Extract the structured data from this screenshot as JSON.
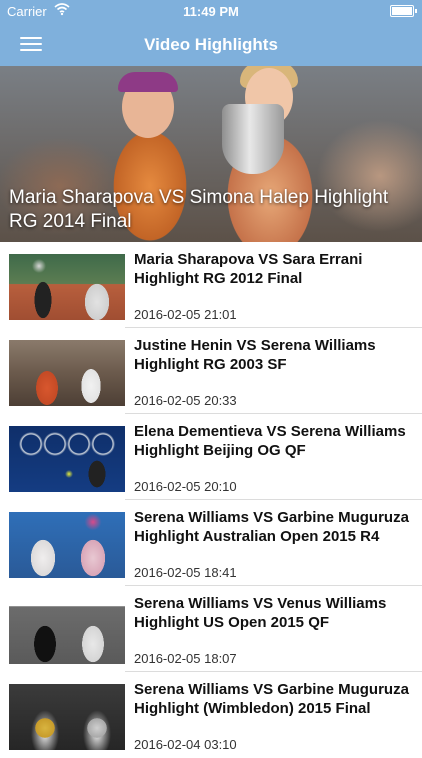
{
  "status_bar": {
    "carrier": "Carrier",
    "wifi_icon": "wifi-icon",
    "time": "11:49 PM",
    "battery_icon": "battery-icon",
    "battery_level": 1.0
  },
  "nav": {
    "menu_icon": "hamburger-menu-icon",
    "title": "Video Highlights",
    "background_color": "#7fb0dc"
  },
  "featured": {
    "title": "Maria Sharapova VS Simona Halep Highlight RG 2014 Final"
  },
  "videos": [
    {
      "title": "Maria Sharapova VS Sara Errani Highlight RG 2012 Final",
      "date": "2016-02-05 21:01"
    },
    {
      "title": "Justine Henin VS Serena Williams Highlight RG 2003 SF",
      "date": "2016-02-05 20:33"
    },
    {
      "title": "Elena Dementieva VS Serena Williams Highlight Beijing OG QF",
      "date": "2016-02-05 20:10"
    },
    {
      "title": "Serena Williams VS Garbine Muguruza Highlight Australian Open 2015 R4",
      "date": "2016-02-05 18:41"
    },
    {
      "title": "Serena Williams VS Venus Williams Highlight US Open 2015 QF",
      "date": "2016-02-05 18:07"
    },
    {
      "title": "Serena Williams VS Garbine Muguruza Highlight (Wimbledon) 2015 Final",
      "date": "2016-02-04 03:10"
    }
  ]
}
